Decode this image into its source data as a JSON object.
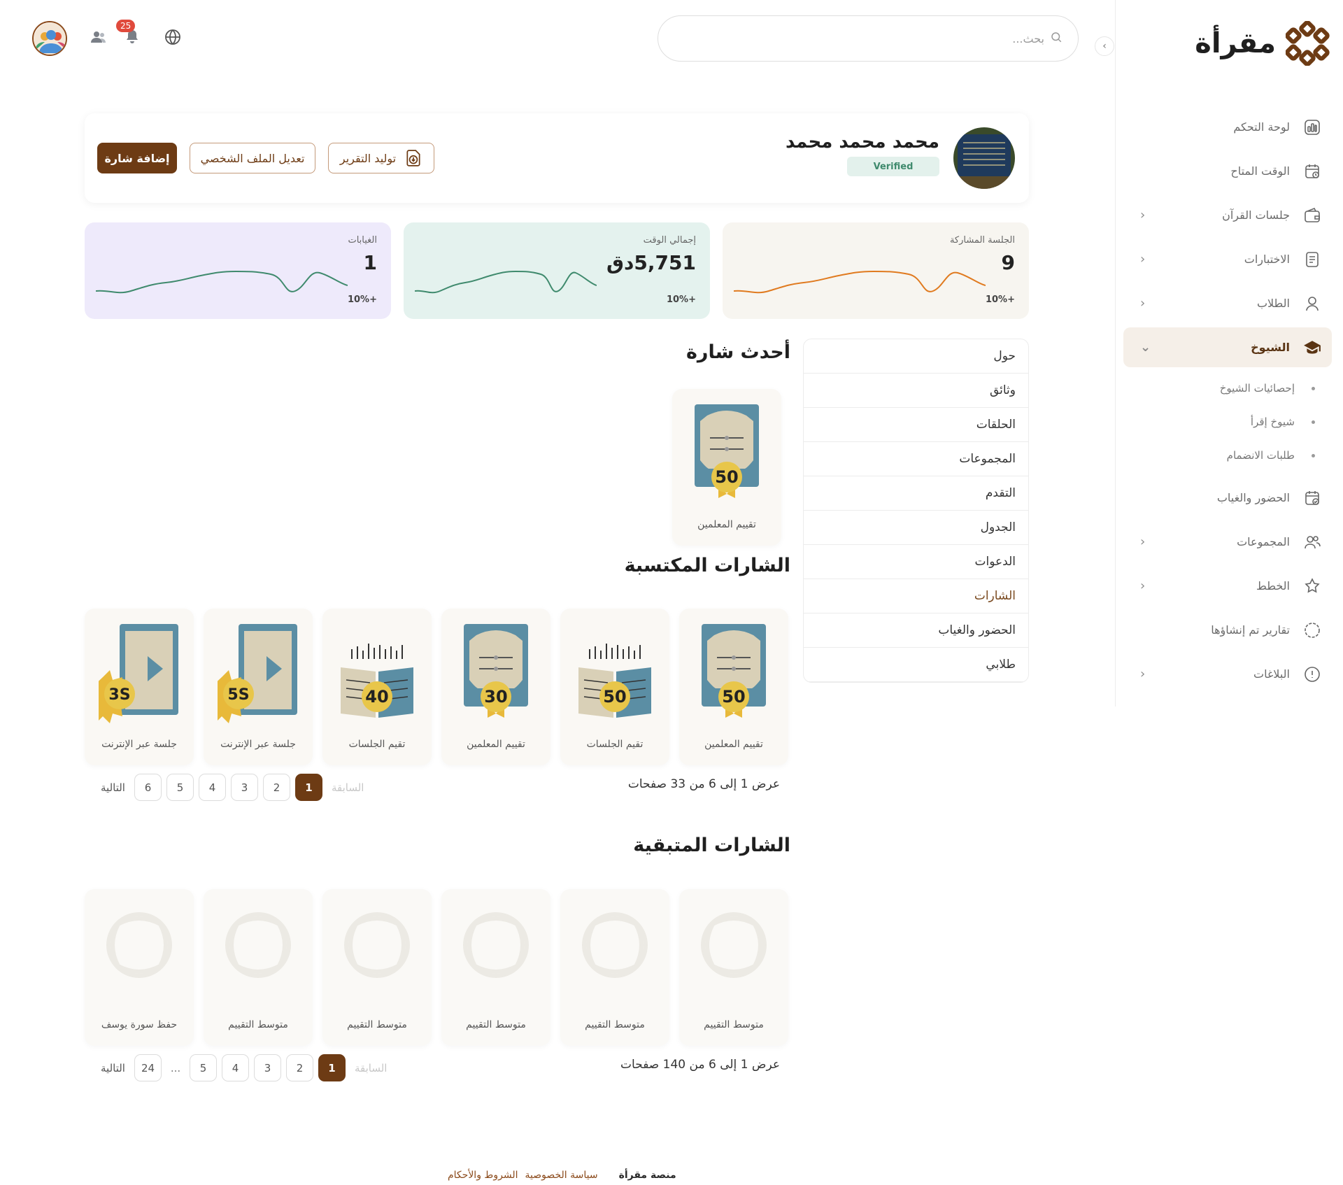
{
  "brand": {
    "name": "مقرأة"
  },
  "search": {
    "placeholder": "بحث..."
  },
  "header": {
    "notifications_count": "25"
  },
  "sidebar": {
    "items": [
      {
        "label": "لوحة التحكم",
        "icon": "dashboard-icon"
      },
      {
        "label": "الوقت المتاح",
        "icon": "calendar-icon"
      },
      {
        "label": "جلسات القرآن",
        "icon": "wallet-icon"
      },
      {
        "label": "الاختبارات",
        "icon": "document-icon"
      },
      {
        "label": "الطلاب",
        "icon": "user-icon"
      },
      {
        "label": "الشيوخ",
        "icon": "graduation-cap-icon"
      },
      {
        "label": "الحضور والغياب",
        "icon": "calendar-check-icon"
      },
      {
        "label": "المجموعات",
        "icon": "users-icon"
      },
      {
        "label": "الخطط",
        "icon": "badge-star-icon"
      },
      {
        "label": "تقارير تم إنشاؤها",
        "icon": "loader-icon"
      },
      {
        "label": "البلاغات",
        "icon": "alert-circle-icon"
      }
    ],
    "sheikh_sub": [
      "إحصائيات الشيوخ",
      "شيوخ إقرأ",
      "طلبات الانضمام"
    ]
  },
  "profile": {
    "name": "محمد محمد محمد",
    "status": "Verified",
    "actions": {
      "report": "توليد التقرير",
      "edit": "تعديل الملف الشخصي",
      "add_badge": "إضافة شارة"
    }
  },
  "stats": [
    {
      "label": "الجلسة المشاركة",
      "value": "9",
      "delta": "+10%",
      "color": "#e07a1f",
      "bg": "#f7f5f0"
    },
    {
      "label": "إجمالي الوقت",
      "value": "5,751دق",
      "delta": "+10%",
      "color": "#3f8a6d",
      "bg": "#e4f2ee"
    },
    {
      "label": "الغيابات",
      "value": "1",
      "delta": "+10%",
      "color": "#3f8a6d",
      "bg": "#eeeafb"
    }
  ],
  "tabs": [
    "حول",
    "وثائق",
    "الحلقات",
    "المجموعات",
    "التقدم",
    "الجدول",
    "الدعوات",
    "الشارات",
    "الحضور والغياب",
    "طلابي"
  ],
  "latest": {
    "title": "أحدث شارة",
    "badge": {
      "label": "تقييم المعلمين",
      "num": "50"
    }
  },
  "earned": {
    "title": "الشارات المكتسبة",
    "badges": [
      {
        "label": "تقييم المعلمين",
        "num": "50",
        "kind": "teacher"
      },
      {
        "label": "تقيم الجلسات",
        "num": "50",
        "kind": "session"
      },
      {
        "label": "تقييم المعلمين",
        "num": "30",
        "kind": "teacher"
      },
      {
        "label": "تقيم الجلسات",
        "num": "40",
        "kind": "session"
      },
      {
        "label": "جلسة عبر الإنترنت",
        "num": "5S",
        "kind": "online"
      },
      {
        "label": "جلسة عبر الإنترنت",
        "num": "3S",
        "kind": "online"
      }
    ],
    "info": "عرض 1 إلى 6 من 33 صفحات",
    "pages": [
      "1",
      "2",
      "3",
      "4",
      "5",
      "6"
    ],
    "prev": "السابقة",
    "next": "التالية"
  },
  "remaining": {
    "title": "الشارات المتبقية",
    "badges": [
      "متوسط التقييم",
      "متوسط التقييم",
      "متوسط التقييم",
      "متوسط التقييم",
      "متوسط التقييم",
      "حفظ سورة يوسف"
    ],
    "info": "عرض 1 إلى 6 من 140 صفحات",
    "pages": [
      "1",
      "2",
      "3",
      "4",
      "5"
    ],
    "ellipsis": "...",
    "last_page": "24",
    "prev": "السابقة",
    "next": "التالية"
  },
  "footer": {
    "brand": "منصة مقرأة",
    "privacy": "سياسة الخصوصية",
    "terms": "الشروط والأحكام"
  }
}
